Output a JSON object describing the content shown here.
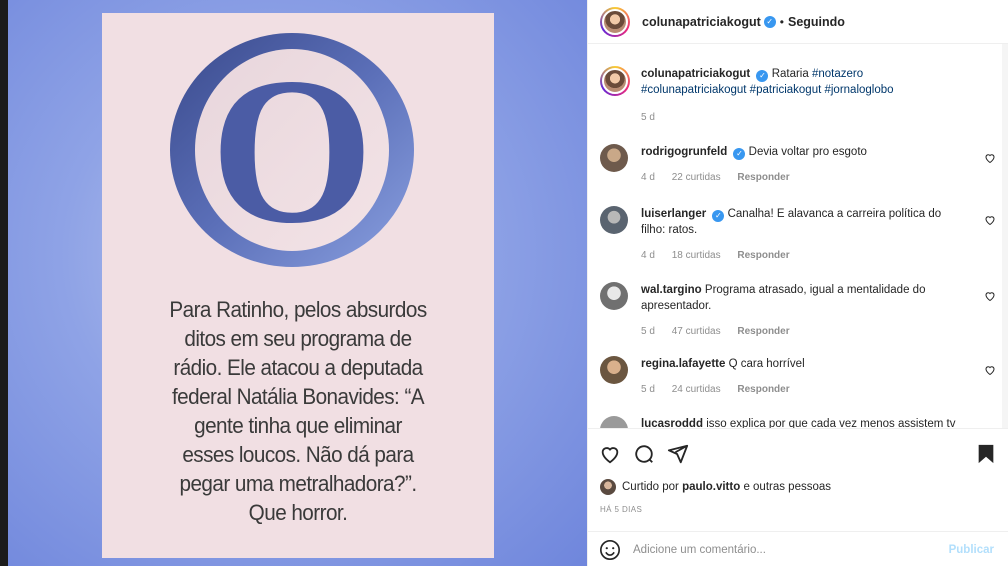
{
  "post": {
    "logo_letter": "O",
    "quote": "Para Ratinho, pelos absurdos ditos em seu programa de rádio. Ele atacou a deputada federal Natália Bonavides: “A gente tinha que eliminar esses loucos. Não dá para pegar uma metralhadora?”. Que horror."
  },
  "header": {
    "username": "colunapatriciakogut",
    "separator": "•",
    "follow_label": "Seguindo"
  },
  "caption": {
    "username": "colunapatriciakogut",
    "text": "Rataria",
    "hashtags": "#notazero #colunapatriciakogut #patriciakogut #jornaloglobo",
    "time": "5 d"
  },
  "comments": [
    {
      "user": "rodrigogrunfeld",
      "verified": true,
      "text": "Devia voltar pro esgoto",
      "time": "4 d",
      "likes": "22 curtidas",
      "reply": "Responder"
    },
    {
      "user": "luiserlanger",
      "verified": true,
      "text": "Canalha! E alavanca a carreira política do filho: ratos.",
      "time": "4 d",
      "likes": "18 curtidas",
      "reply": "Responder"
    },
    {
      "user": "wal.targino",
      "verified": false,
      "text": "Programa atrasado, igual a mentalidade do apresentador.",
      "time": "5 d",
      "likes": "47 curtidas",
      "reply": "Responder"
    },
    {
      "user": "regina.lafayette",
      "verified": false,
      "text": "Q cara horrível",
      "time": "5 d",
      "likes": "24 curtidas",
      "reply": "Responder"
    },
    {
      "user": "lucasroddd",
      "verified": false,
      "text": "isso explica por que cada vez menos assistem tv",
      "time": "",
      "likes": "",
      "reply": ""
    }
  ],
  "actions": {
    "liked_prefix": "Curtido por",
    "liked_user": "paulo.vitto",
    "liked_suffix": "e outras pessoas",
    "time_ago": "HÁ 5 DIAS",
    "comment_placeholder": "Adicione um comentário...",
    "publish_label": "Publicar"
  },
  "colors": {
    "accent": "#3897f0",
    "publish_disabled": "#b2dffc",
    "link": "#00376b"
  }
}
